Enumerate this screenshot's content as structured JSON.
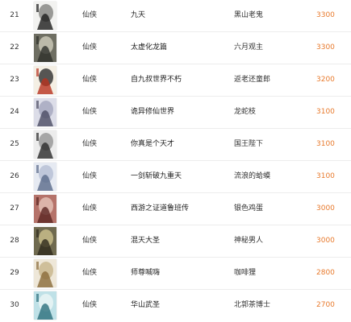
{
  "rows": [
    {
      "rank": "21",
      "genre": "仙侠",
      "title": "九天",
      "author": "黑山老鬼",
      "score": "3300",
      "cover": {
        "bg": "#f2f2f0",
        "accent": "#1d1d1d",
        "mid": "#8a8a86"
      }
    },
    {
      "rank": "22",
      "genre": "仙侠",
      "title": "太虚化龙篇",
      "author": "六月观主",
      "score": "3300",
      "cover": {
        "bg": "#6e6e62",
        "accent": "#2e2f2a",
        "mid": "#c9c7b6"
      }
    },
    {
      "rank": "23",
      "genre": "仙侠",
      "title": "自九叔世界不朽",
      "author": "返老还童郎",
      "score": "3200",
      "cover": {
        "bg": "#f4efe4",
        "accent": "#b8321f",
        "mid": "#3a3a3a"
      }
    },
    {
      "rank": "24",
      "genre": "仙侠",
      "title": "诡异修仙世界",
      "author": "龙蛇枝",
      "score": "3100",
      "cover": {
        "bg": "#dcdde8",
        "accent": "#4b4c63",
        "mid": "#a7a9c0"
      }
    },
    {
      "rank": "25",
      "genre": "仙侠",
      "title": "你真是个天才",
      "author": "国王陛下",
      "score": "3100",
      "cover": {
        "bg": "#ececec",
        "accent": "#2a2a2a",
        "mid": "#9a9a9a"
      }
    },
    {
      "rank": "26",
      "genre": "仙侠",
      "title": "一剑斩破九重天",
      "author": "流浪的蛤蟆",
      "score": "3100",
      "cover": {
        "bg": "#e6eaf2",
        "accent": "#5a6a8a",
        "mid": "#b7c1d6"
      }
    },
    {
      "rank": "27",
      "genre": "仙侠",
      "title": "西游之证道鲁班传",
      "author": "银色鸡蛋",
      "score": "3000",
      "cover": {
        "bg": "#b5736a",
        "accent": "#5b2622",
        "mid": "#e3c0b4"
      }
    },
    {
      "rank": "28",
      "genre": "仙侠",
      "title": "混天大圣",
      "author": "神秘男人",
      "score": "3000",
      "cover": {
        "bg": "#6f6a4f",
        "accent": "#2f2b1c",
        "mid": "#c8bc8a"
      }
    },
    {
      "rank": "29",
      "genre": "仙侠",
      "title": "师尊喊嗨",
      "author": "咖啡狸",
      "score": "2800",
      "cover": {
        "bg": "#eee7d8",
        "accent": "#8a6b3a",
        "mid": "#c9b78f"
      }
    },
    {
      "rank": "30",
      "genre": "仙侠",
      "title": "华山武圣",
      "author": "北郭茶博士",
      "score": "2700",
      "cover": {
        "bg": "#bfe1e7",
        "accent": "#2c6f7c",
        "mid": "#e9f4f4"
      }
    }
  ]
}
